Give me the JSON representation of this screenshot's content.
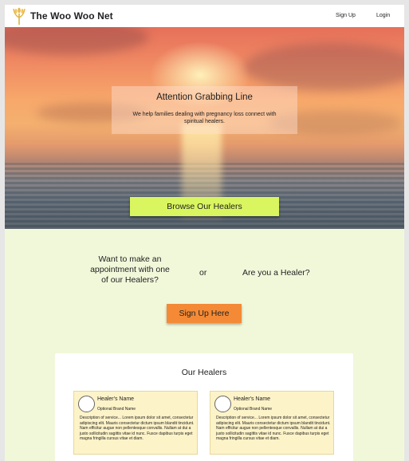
{
  "header": {
    "brand": "The Woo Woo Net",
    "links": [
      {
        "label": "Sign Up"
      },
      {
        "label": "Login"
      }
    ]
  },
  "hero": {
    "title": "Attention Grabbing Line",
    "subtitle": "We help families dealing with pregnancy loss connect with spiritual healers.",
    "cta_label": "Browse Our Healers"
  },
  "cta": {
    "question_left": "Want to make an appointment with one of our Healers?",
    "or_text": "or",
    "question_right": "Are you a Healer?",
    "button_label": "Sign Up Here"
  },
  "healers": {
    "title": "Our Healers",
    "cards": [
      {
        "name": "Healer's Name",
        "brand": "Optional Brand Name",
        "description": "Description of service... Lorem ipsum dolor sit amet, consectetur adipiscing elit. Mauris consectetur dictum ipsum blandit tincidunt. Nam efficitur augue non pellentesque convallis. Nullam at dui a justo sollicitudin sagittis vitae id nunc. Fusce dapibus turpis eget magna fringilla cursus vitae et diam."
      },
      {
        "name": "Healer's Name",
        "brand": "Optional Brand Name",
        "description": "Description of service... Lorem ipsum dolor sit amet, consectetur adipiscing elit. Mauris consectetur dictum ipsum blandit tincidunt. Nam efficitur augue non pellentesque convallis. Nullam at dui a justo sollicitudin sagittis vitae id nunc. Fusce dapibus turpis eget magna fringilla cursus vitae et diam."
      }
    ]
  },
  "colors": {
    "section_bg": "#f1f8da",
    "browse_button": "#d9f55f",
    "signup_button": "#f48a35",
    "card_bg": "#fdf3c8"
  },
  "icons": {
    "logo": "wheat-logo-icon",
    "avatar": "avatar-circle"
  }
}
